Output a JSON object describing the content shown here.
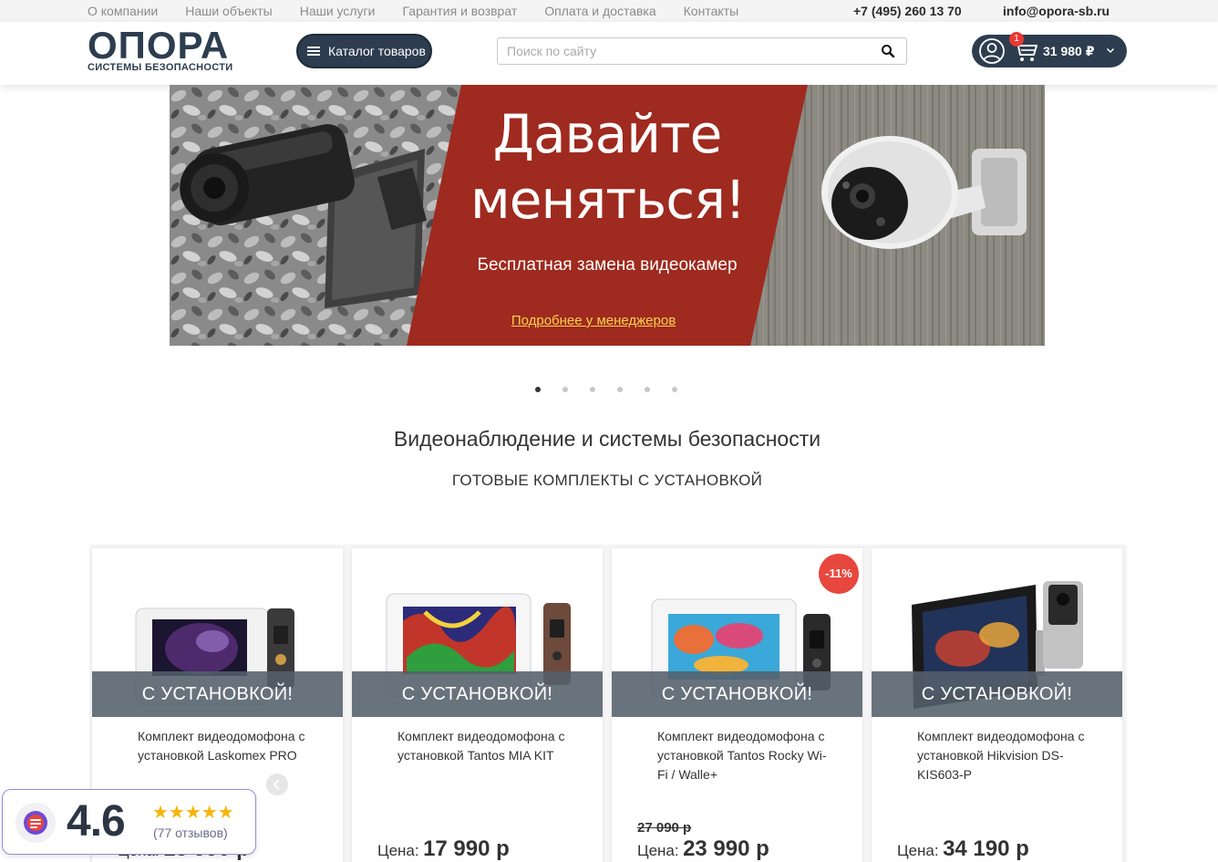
{
  "topbar": {
    "nav": [
      "О компании",
      "Наши объекты",
      "Наши услуги",
      "Гарантия и возврат",
      "Оплата и доставка",
      "Контакты"
    ],
    "phone": "+7 (495) 260 13 70",
    "email": "info@opora-sb.ru"
  },
  "header": {
    "logo_word": "ОПОРА",
    "logo_sub": "СИСТЕМЫ БЕЗОПАСНОСТИ",
    "catalog_label": "Каталог товаров",
    "search_placeholder": "Поиск по сайту",
    "cart_count": "1",
    "cart_total": "31 980 ₽"
  },
  "banner": {
    "title": "Давайте меняться!",
    "subtitle": "Бесплатная замена видеокамер",
    "link": "Подробнее у менеджеров",
    "slides": 6,
    "active_slide": 1
  },
  "section": {
    "title": "Видеонаблюдение и системы безопасности",
    "subtitle": "ГОТОВЫЕ КОМПЛЕКТЫ С УСТАНОВКОЙ"
  },
  "products": [
    {
      "band": "С УСТАНОВКОЙ!",
      "title": "Комплект видеодомофона с установкой Laskomex PRO",
      "old_price": "",
      "price_label": "Цена:",
      "price": "15 990 р",
      "discount": ""
    },
    {
      "band": "С УСТАНОВКОЙ!",
      "title": "Комплект видеодомофона с установкой Tantos MIA KIT",
      "old_price": "",
      "price_label": "Цена:",
      "price": "17 990 р",
      "discount": ""
    },
    {
      "band": "С УСТАНОВКОЙ!",
      "title": "Комплект видеодомофона с установкой Tantos Rocky Wi-Fi / Walle+",
      "old_price": "27 090 р",
      "price_label": "Цена:",
      "price": "23 990 р",
      "discount": "-11%"
    },
    {
      "band": "С УСТАНОВКОЙ!",
      "title": "Комплект видеодомофона с установкой Hikvision DS-KIS603-P",
      "old_price": "",
      "price_label": "Цена:",
      "price": "34 190 р",
      "discount": ""
    }
  ],
  "rating": {
    "score": "4.6",
    "stars": "★★★★★",
    "reviews": "(77 отзывов)"
  },
  "colors": {
    "brand_dark": "#2d3d4f",
    "banner_red": "#9f2a1f",
    "badge_red": "#e8473e",
    "link_yellow": "#f6d24c"
  }
}
